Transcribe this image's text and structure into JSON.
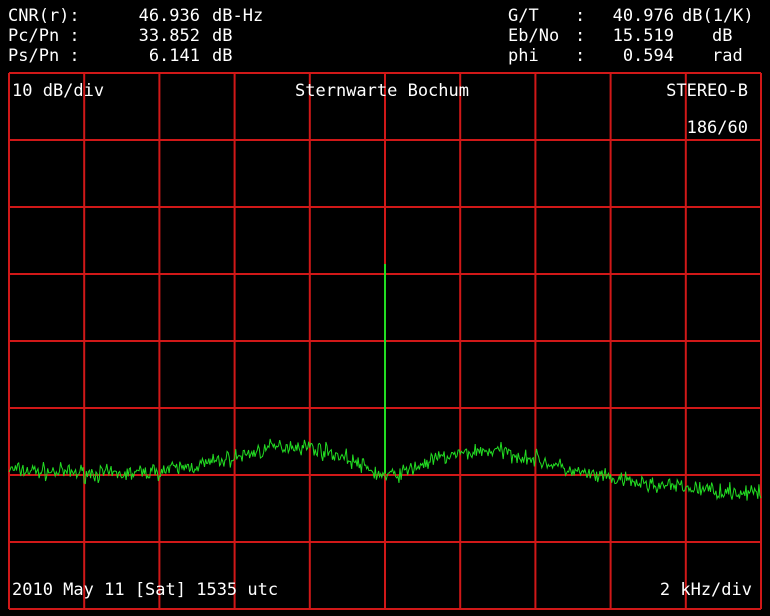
{
  "readouts_left": [
    {
      "label": "CNR(r):",
      "value": "46.936",
      "unit": "dB-Hz"
    },
    {
      "label": "Pc/Pn :",
      "value": "33.852",
      "unit": "dB"
    },
    {
      "label": "Ps/Pn :",
      "value": "6.141",
      "unit": "dB"
    }
  ],
  "readouts_right": [
    {
      "label": "G/T",
      "colon": ":",
      "value": "40.976",
      "unit": "dB(1/K)"
    },
    {
      "label": "Eb/No",
      "colon": ":",
      "value": "15.519",
      "unit": "dB"
    },
    {
      "label": "phi",
      "colon": ":",
      "value": "0.594",
      "unit": "rad"
    }
  ],
  "chart_data": {
    "type": "line",
    "title": "Sternwarte Bochum",
    "scale_label": "10 dB/div",
    "station_label": "STEREO-B",
    "counter_label": "186/60",
    "timestamp_label": "2010 May 11 [Sat] 1535 utc",
    "xscale_label": "2 kHz/div",
    "x_unit": "kHz",
    "y_unit": "dB",
    "xlim": [
      -10,
      10
    ],
    "ylim": [
      -60,
      20
    ],
    "grid": {
      "on": true,
      "x_divisions": 10,
      "y_divisions": 8,
      "color": "#d01818"
    },
    "series": [
      {
        "color": "#22dd22",
        "noise_db": 0.6,
        "x": [
          -10,
          -9,
          -8,
          -7,
          -6,
          -5,
          -4,
          -3,
          -2.5,
          -2,
          -1.5,
          -1,
          -0.5,
          0,
          0.5,
          1,
          1.5,
          2,
          2.5,
          3,
          4,
          5,
          6,
          7,
          8,
          9,
          10
        ],
        "y": [
          -39.2,
          -39.5,
          -39.7,
          -39.9,
          -39.4,
          -38.6,
          -37.4,
          -35.9,
          -35.6,
          -35.8,
          -36.6,
          -37.5,
          -39.0,
          -40.3,
          -39.6,
          -38.4,
          -37.4,
          -36.9,
          -36.4,
          -36.4,
          -37.6,
          -39.5,
          -40.6,
          -41.4,
          -41.9,
          -42.4,
          -42.8
        ]
      }
    ],
    "carrier": {
      "x": 0,
      "y_peak": -8.5,
      "y_base": -39.8,
      "color": "#22dd22"
    }
  }
}
